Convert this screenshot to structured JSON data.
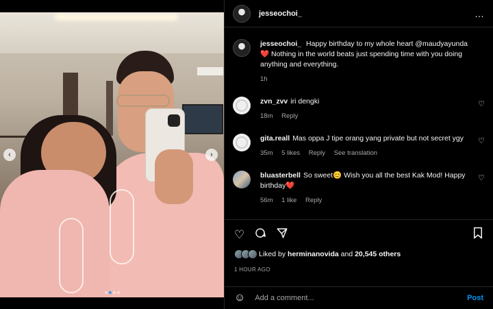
{
  "post": {
    "author": "jesseochoi_",
    "more_icon": "…",
    "caption": {
      "username": "jesseochoi_",
      "text": "Happy birthday to my whole heart @maudyayunda",
      "heart": "❤️",
      "text2": "Nothing in the world beats just spending time with you doing anything and everything.",
      "time": "1h"
    },
    "comments": [
      {
        "username": "zvn_zvv",
        "text": "iri dengki",
        "time": "18m",
        "reply": "Reply",
        "avatar": "default"
      },
      {
        "username": "gita.reall",
        "text": "Mas oppa J tipe orang yang private but not secret ygy",
        "time": "35m",
        "likes": "5 likes",
        "reply": "Reply",
        "translate": "See translation",
        "avatar": "default"
      },
      {
        "username": "bluasterbell",
        "text": "So sweet😊 Wish you all the best Kak Mod! Happy birthday",
        "heart": "❤️",
        "time": "56m",
        "likes": "1 like",
        "reply": "Reply",
        "avatar": "photo"
      }
    ],
    "likes": {
      "prefix": "Liked by",
      "user": "herminanovida",
      "and": "and",
      "others": "20,545 others"
    },
    "posted_time": "1 HOUR AGO",
    "add_comment_placeholder": "Add a comment...",
    "post_label": "Post"
  },
  "carousel": {
    "total": 4,
    "active": 1
  },
  "icons": {
    "like": "heart-outline-icon",
    "comment": "comment-bubble-icon",
    "share": "paper-plane-icon",
    "save": "bookmark-icon",
    "emoji": "smiley-icon"
  },
  "colors": {
    "background": "#000000",
    "link": "#0095f6",
    "heart": "#ed4956",
    "muted": "#a8a8a8"
  }
}
